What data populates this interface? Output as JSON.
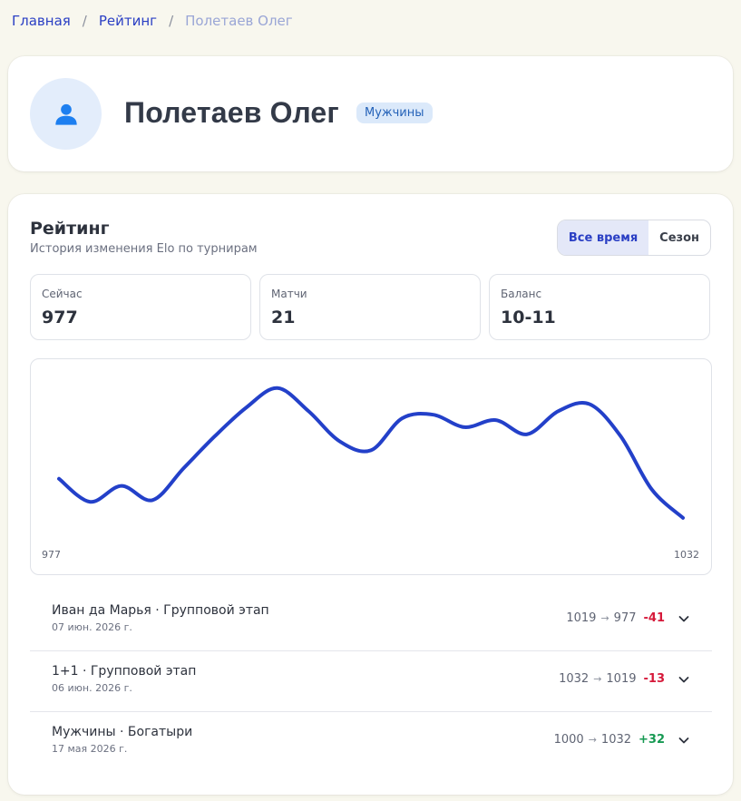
{
  "breadcrumb": {
    "home": "Главная",
    "rating": "Рейтинг",
    "current": "Полетаев Олег",
    "separator": "/"
  },
  "profile": {
    "name": "Полетаев Олег",
    "category": "Мужчины",
    "avatar_icon": "user-icon"
  },
  "rating": {
    "title": "Рейтинг",
    "subtitle": "История изменения Elo по турнирам",
    "period_options": [
      "Все время",
      "Сезон"
    ],
    "period_selected": "Все время"
  },
  "stats": [
    {
      "label": "Сейчас",
      "value": "977"
    },
    {
      "label": "Матчи",
      "value": "21"
    },
    {
      "label": "Баланс",
      "value": "10-11"
    }
  ],
  "chart": {
    "left_label": "977",
    "right_label": "1032",
    "line_color": "#2340c9"
  },
  "chart_data": {
    "type": "line",
    "x": [
      1,
      2,
      3,
      4,
      5,
      6,
      7,
      8,
      9,
      10,
      11,
      12,
      13,
      14,
      15,
      16,
      17,
      18,
      19,
      20,
      21
    ],
    "series": [
      {
        "values": [
          0.44,
          0.31,
          0.4,
          0.32,
          0.5,
          0.68,
          0.84,
          0.95,
          0.82,
          0.65,
          0.6,
          0.78,
          0.8,
          0.73,
          0.77,
          0.69,
          0.82,
          0.86,
          0.68,
          0.38,
          0.22
        ]
      }
    ]
  },
  "history": [
    {
      "title": "Иван да Марья · Групповой этап",
      "date": "07 июн. 2026 г.",
      "from": "1019",
      "to": "977",
      "delta": "-41",
      "sign": "neg"
    },
    {
      "title": "1+1 · Групповой этап",
      "date": "06 июн. 2026 г.",
      "from": "1032",
      "to": "1019",
      "delta": "-13",
      "sign": "neg"
    },
    {
      "title": "Мужчины · Богатыри",
      "date": "17 мая 2026 г.",
      "from": "1000",
      "to": "1032",
      "delta": "+32",
      "sign": "pos"
    }
  ],
  "arrow_glyph": "→",
  "colors": {
    "accent": "#2a3fc4",
    "negative": "#d6193a",
    "positive": "#169952"
  }
}
